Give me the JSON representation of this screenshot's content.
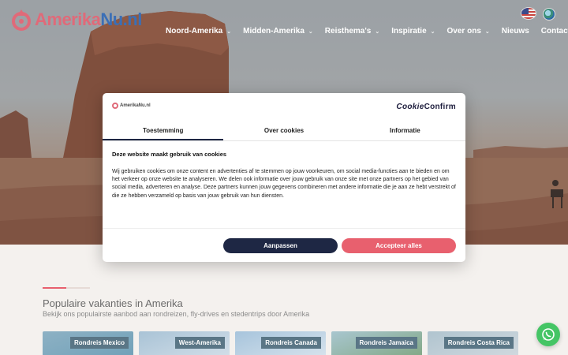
{
  "header": {
    "logo_text_main": "Amerika",
    "logo_text_accent": "Nu.nl",
    "nav": [
      {
        "label": "Noord-Amerika",
        "has_dropdown": true
      },
      {
        "label": "Midden-Amerika",
        "has_dropdown": true
      },
      {
        "label": "Reisthema's",
        "has_dropdown": true
      },
      {
        "label": "Inspiratie",
        "has_dropdown": true
      },
      {
        "label": "Over ons",
        "has_dropdown": true
      },
      {
        "label": "Nieuws",
        "has_dropdown": false
      },
      {
        "label": "Contact",
        "has_dropdown": false
      }
    ],
    "flags": [
      "us-flag-icon",
      "globe-icon"
    ]
  },
  "cookie_dialog": {
    "brand_logo": "AmerikaNu.nl",
    "provider_logo_a": "Cookie",
    "provider_logo_b": "Confirm",
    "tabs": [
      {
        "label": "Toestemming",
        "active": true
      },
      {
        "label": "Over cookies",
        "active": false
      },
      {
        "label": "Informatie",
        "active": false
      }
    ],
    "heading": "Deze website maakt gebruik van cookies",
    "body": "Wij gebruiken cookies om onze content en advertenties af te stemmen op jouw voorkeuren, om social media-functies aan te bieden en om het verkeer op onze website te analyseren. We delen ook informatie over jouw gebruik van onze site met onze partners op het gebied van social media, adverteren en analyse. Deze partners kunnen jouw gegevens combineren met andere informatie die je aan ze hebt verstrekt of die ze hebben verzameld op basis van jouw gebruik van hun diensten.",
    "customize_label": "Aanpassen",
    "accept_label": "Accepteer alles"
  },
  "section": {
    "title": "Populaire vakanties in Amerika",
    "subtitle": "Bekijk ons populairste aanbod aan rondreizen, fly-drives en stedentrips door Amerika",
    "cards": [
      {
        "label": "Rondreis Mexico"
      },
      {
        "label": "West-Amerika"
      },
      {
        "label": "Rondreis Canada"
      },
      {
        "label": "Rondreis Jamaica"
      },
      {
        "label": "Rondreis Costa Rica"
      }
    ]
  },
  "colors": {
    "accent": "#e8606e",
    "navy": "#1e2744",
    "whatsapp": "#45c565"
  }
}
